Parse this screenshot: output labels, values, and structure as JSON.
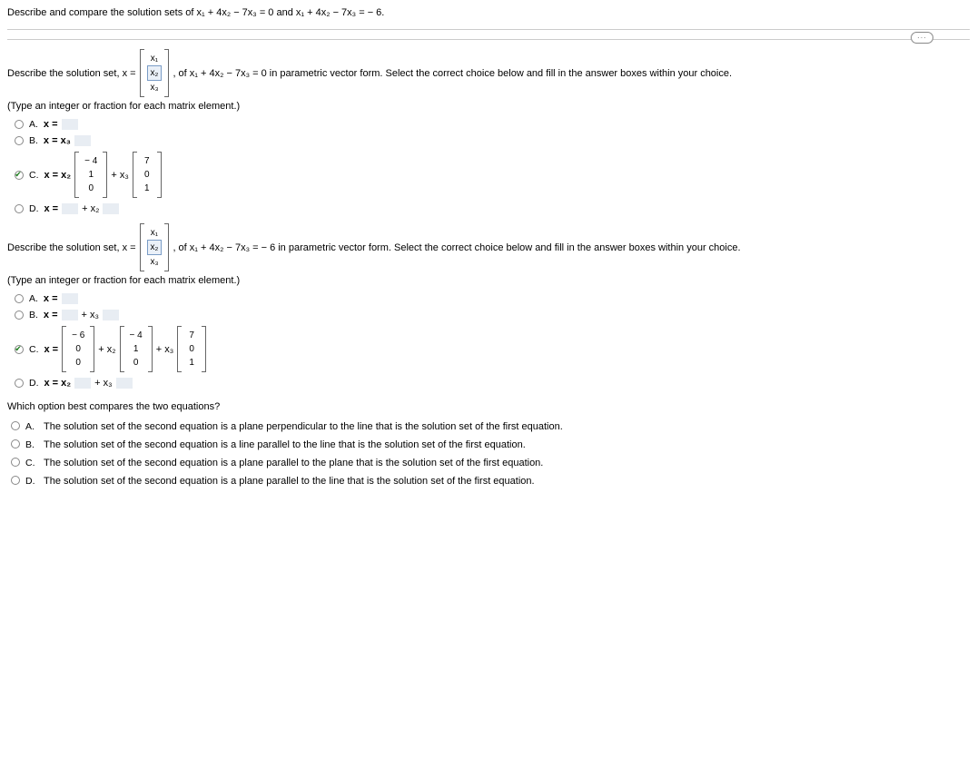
{
  "header": {
    "text": "Describe and compare the solution sets of x₁ + 4x₂ − 7x₃ = 0 and x₁ + 4x₂ − 7x₃ = − 6."
  },
  "dots": "···",
  "part1": {
    "lead_in": "Describe the solution set, x =",
    "vec_labels": [
      "x₁",
      "x₂",
      "x₃"
    ],
    "tail": ", of x₁ + 4x₂ − 7x₃ = 0 in parametric vector form. Select the correct choice below and fill in the answer boxes within your choice.",
    "note": "(Type an integer or fraction for each matrix element.)",
    "options": {
      "A": {
        "label": "A.",
        "prefix": "x ="
      },
      "B": {
        "label": "B.",
        "prefix": "x = x₃"
      },
      "C": {
        "label": "C.",
        "prefix": "x = x₂",
        "vec1": [
          "− 4",
          "1",
          "0"
        ],
        "mid": "+ x₃",
        "vec2": [
          "7",
          "0",
          "1"
        ]
      },
      "D": {
        "label": "D.",
        "prefix": "x =",
        "mid": "+ x₂"
      }
    }
  },
  "part2": {
    "lead_in": "Describe the solution set, x =",
    "vec_labels": [
      "x₁",
      "x₂",
      "x₃"
    ],
    "tail": ", of x₁ + 4x₂ − 7x₃ = − 6 in parametric vector form. Select the correct choice below and fill in the answer boxes within your choice.",
    "note": "(Type an integer or fraction for each matrix element.)",
    "options": {
      "A": {
        "label": "A.",
        "prefix": "x ="
      },
      "B": {
        "label": "B.",
        "prefix": "x =",
        "mid": "+ x₃"
      },
      "C": {
        "label": "C.",
        "prefix": "x =",
        "vec1": [
          "− 6",
          "0",
          "0"
        ],
        "mid1": "+ x₂",
        "vec2": [
          "− 4",
          "1",
          "0"
        ],
        "mid2": "+ x₃",
        "vec3": [
          "7",
          "0",
          "1"
        ]
      },
      "D": {
        "label": "D.",
        "prefix": "x = x₂",
        "mid": "+ x₃"
      }
    }
  },
  "part3": {
    "question": "Which option best compares the two equations?",
    "options": {
      "A": {
        "label": "A.",
        "text": "The solution set of the second equation is a plane perpendicular to the line that is the solution set of the first equation."
      },
      "B": {
        "label": "B.",
        "text": "The solution set of the second equation is a line parallel to the line that is the solution set of the first equation."
      },
      "C": {
        "label": "C.",
        "text": "The solution set of the second equation is a plane parallel to the plane that is the solution set of the first equation."
      },
      "D": {
        "label": "D.",
        "text": "The solution set of the second equation is a plane parallel to the line that is the solution set of the first equation."
      }
    }
  }
}
